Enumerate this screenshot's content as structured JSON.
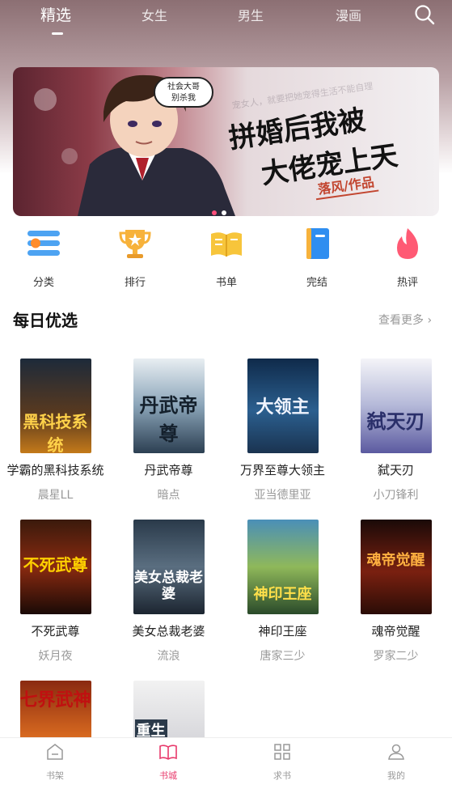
{
  "top_tabs": [
    {
      "label": "精选",
      "active": true
    },
    {
      "label": "女生",
      "active": false
    },
    {
      "label": "男生",
      "active": false
    },
    {
      "label": "漫画",
      "active": false
    }
  ],
  "banner": {
    "speech_line1": "社会大哥",
    "speech_line2": "别杀我",
    "background_text": "宠女人，就要把她宠得生活不能自理",
    "title_line1": "拼婚后我被",
    "title_line2": "大佬宠上天",
    "author_tag": "落风/作品",
    "slide_count": 2,
    "active_slide": 1
  },
  "categories": [
    {
      "label": "分类",
      "icon": "category-list-icon",
      "color": "#4da3f2"
    },
    {
      "label": "排行",
      "icon": "trophy-icon",
      "color": "#f7b23b"
    },
    {
      "label": "书单",
      "icon": "open-book-icon",
      "color": "#f7c53b"
    },
    {
      "label": "完结",
      "icon": "closed-book-icon",
      "color": "#2f8ef0"
    },
    {
      "label": "热评",
      "icon": "flame-icon",
      "color": "#ff5a74"
    }
  ],
  "section": {
    "title": "每日优选",
    "more_label": "查看更多 ›"
  },
  "books": [
    {
      "title": "学霸的黑科技系统",
      "author": "晨星LL",
      "cover_text": "黑科技系统"
    },
    {
      "title": "丹武帝尊",
      "author": "暗点",
      "cover_text": "丹武帝尊"
    },
    {
      "title": "万界至尊大领主",
      "author": "亚当德里亚",
      "cover_text": "大领主"
    },
    {
      "title": "弑天刃",
      "author": "小刀锋利",
      "cover_text": "弑天刃"
    },
    {
      "title": "不死武尊",
      "author": "妖月夜",
      "cover_text": "不死武尊"
    },
    {
      "title": "美女总裁老婆",
      "author": "流浪",
      "cover_text": "美女总裁老婆"
    },
    {
      "title": "神印王座",
      "author": "唐家三少",
      "cover_text": "神印王座"
    },
    {
      "title": "魂帝觉醒",
      "author": "罗家二少",
      "cover_text": "魂帝觉醒"
    },
    {
      "title": "",
      "author": "",
      "cover_text": "七界武神"
    },
    {
      "title": "",
      "author": "",
      "cover_text": "重生"
    }
  ],
  "bottom_nav": [
    {
      "label": "书架",
      "icon": "bookshelf-icon",
      "active": false
    },
    {
      "label": "书城",
      "icon": "bookstore-icon",
      "active": true
    },
    {
      "label": "求书",
      "icon": "grid-icon",
      "active": false
    },
    {
      "label": "我的",
      "icon": "profile-icon",
      "active": false
    }
  ],
  "colors": {
    "accent": "#e8396b",
    "muted_text": "#999999"
  }
}
